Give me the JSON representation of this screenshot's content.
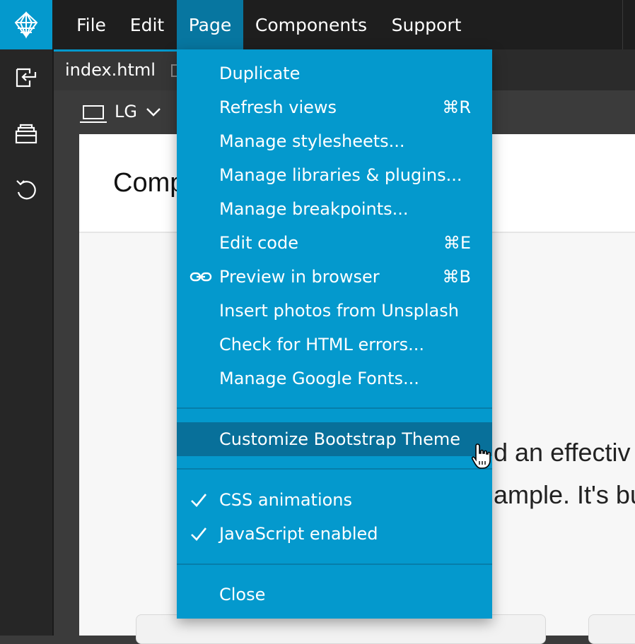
{
  "menubar": {
    "items": [
      {
        "label": "File"
      },
      {
        "label": "Edit"
      },
      {
        "label": "Page"
      },
      {
        "label": "Components"
      },
      {
        "label": "Support"
      }
    ]
  },
  "sidebar": {
    "icons": [
      "import-icon",
      "library-icon",
      "undo-icon"
    ]
  },
  "tab": {
    "filename": "index.html"
  },
  "breakpoint": {
    "label": "LG"
  },
  "canvas": {
    "title": "Comp",
    "line1": "d an effectiv",
    "line2": "ample. It's bui"
  },
  "page_menu": {
    "items": [
      {
        "label": "Duplicate",
        "shortcut": ""
      },
      {
        "label": "Refresh views",
        "shortcut": "⌘R"
      },
      {
        "label": "Manage stylesheets...",
        "shortcut": ""
      },
      {
        "label": "Manage libraries & plugins...",
        "shortcut": ""
      },
      {
        "label": "Manage breakpoints...",
        "shortcut": ""
      },
      {
        "label": "Edit code",
        "shortcut": "⌘E"
      },
      {
        "label": "Preview in browser",
        "shortcut": "⌘B"
      },
      {
        "label": "Insert photos from Unsplash",
        "shortcut": ""
      },
      {
        "label": "Check for HTML errors...",
        "shortcut": ""
      },
      {
        "label": "Manage Google Fonts...",
        "shortcut": ""
      }
    ],
    "highlighted": "Customize Bootstrap Theme",
    "toggles": [
      {
        "label": "CSS animations",
        "checked": true
      },
      {
        "label": "JavaScript enabled",
        "checked": true
      }
    ],
    "close": "Close"
  },
  "colors": {
    "accent": "#0499cd",
    "menu_hover": "#08709a",
    "menubar_bg": "#1e1e1e"
  }
}
